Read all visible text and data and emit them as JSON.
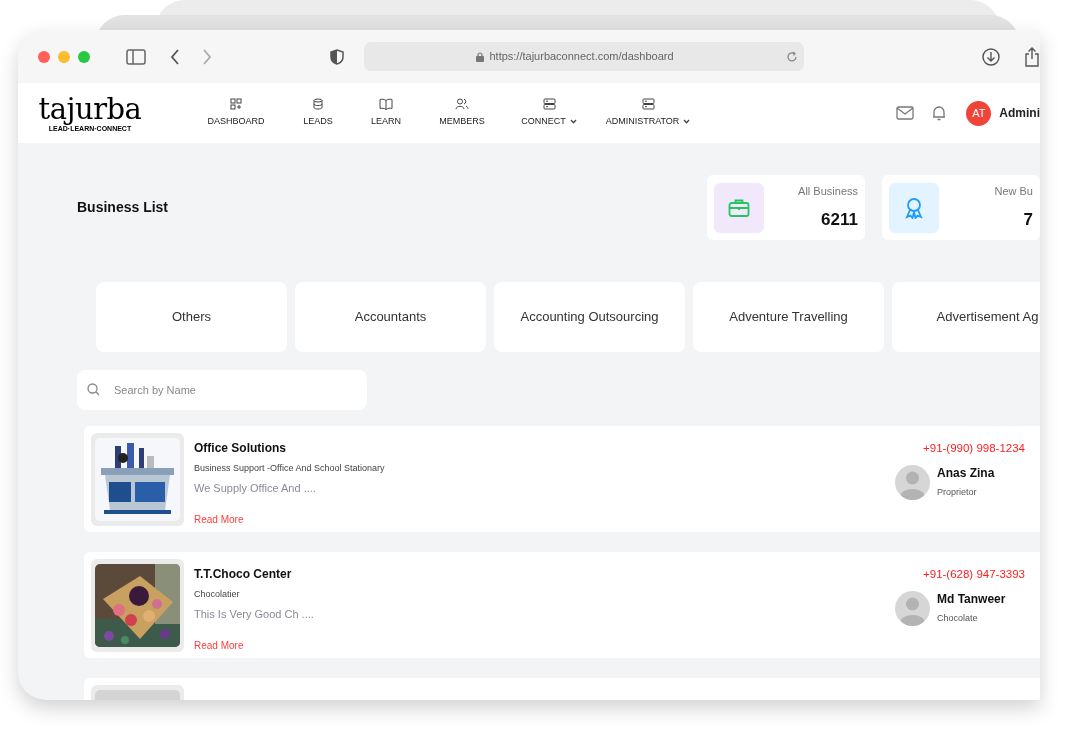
{
  "browser": {
    "url": "https://tajurbaconnect.com/dashboard"
  },
  "nav": {
    "logo": {
      "name": "tajurba",
      "tagline": "LEAD·LEARN·CONNECT"
    },
    "items": [
      {
        "label": "DASHBOARD",
        "dropdown": false
      },
      {
        "label": "LEADS",
        "dropdown": false
      },
      {
        "label": "LEARN",
        "dropdown": false
      },
      {
        "label": "MEMBERS",
        "dropdown": false
      },
      {
        "label": "CONNECT",
        "dropdown": true
      },
      {
        "label": "ADMINISTRATOR",
        "dropdown": true
      }
    ],
    "user": {
      "initials": "AT",
      "name": "Admini"
    }
  },
  "page_title": "Business List",
  "stats": [
    {
      "kind": "briefcase",
      "label": "All Business",
      "value": "6211"
    },
    {
      "kind": "award",
      "label": "New Bu",
      "value": "7"
    }
  ],
  "categories": [
    "Others",
    "Accountants",
    "Accounting Outsourcing",
    "Adventure Travelling",
    "Advertisement Ag"
  ],
  "search": {
    "placeholder": "Search by Name"
  },
  "businesses": [
    {
      "kind": "picture",
      "name": "Office Solutions",
      "category": "Business Support -Office And School Stationary",
      "description": "We Supply Office And ....",
      "link": "Read More",
      "phone": "+91-(990) 998-1234",
      "contact_name": "Anas Zina",
      "contact_role": "Proprietor"
    },
    {
      "kind": "picture",
      "name": "T.T.Choco Center",
      "category": "Chocolatier",
      "description": "This Is Very Good Ch ....",
      "link": "Read More",
      "phone": "+91-(628) 947-3393",
      "contact_name": "Md Tanweer",
      "contact_role": "Chocolate"
    },
    {
      "kind": "placeholder"
    }
  ]
}
